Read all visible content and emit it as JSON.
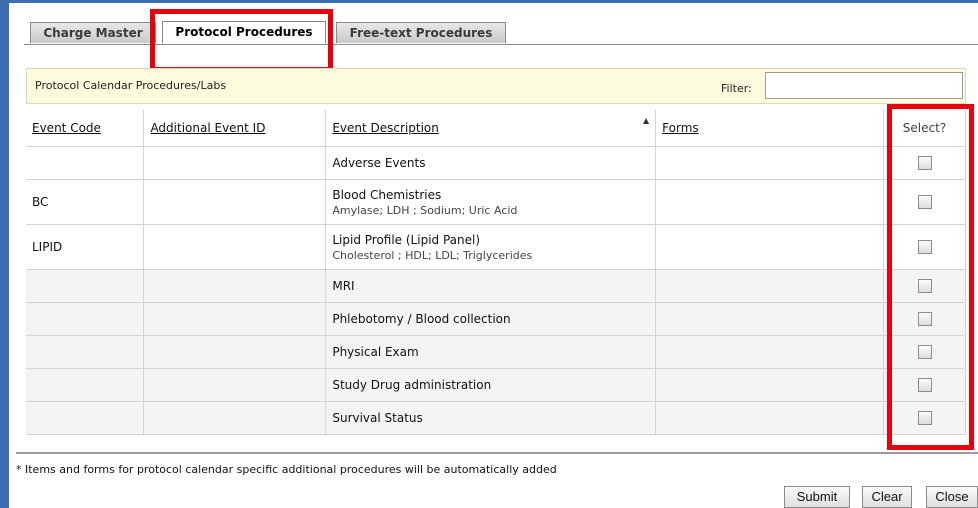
{
  "tabs": [
    {
      "label": "Charge Master"
    },
    {
      "label": "Protocol Procedures"
    },
    {
      "label": "Free-text Procedures"
    }
  ],
  "panel": {
    "title": "Protocol Calendar Procedures/Labs",
    "filter_label": "Filter:",
    "filter_value": ""
  },
  "table": {
    "headers": [
      "Event Code",
      "Additional Event ID",
      "Event Description",
      "Forms",
      "Select?"
    ],
    "rows": [
      {
        "code": "",
        "additional_id": "",
        "description": "Adverse Events",
        "details": "",
        "forms": ""
      },
      {
        "code": "BC",
        "additional_id": "",
        "description": "Blood Chemistries",
        "details": "Amylase; LDH ; Sodium; Uric Acid",
        "forms": ""
      },
      {
        "code": "LIPID",
        "additional_id": "",
        "description": "Lipid Profile (Lipid Panel)",
        "details": "Cholesterol ; HDL; LDL; Triglycerides",
        "forms": ""
      },
      {
        "code": "",
        "additional_id": "",
        "description": "MRI",
        "details": "",
        "forms": ""
      },
      {
        "code": "",
        "additional_id": "",
        "description": "Phlebotomy / Blood collection",
        "details": "",
        "forms": ""
      },
      {
        "code": "",
        "additional_id": "",
        "description": "Physical Exam",
        "details": "",
        "forms": ""
      },
      {
        "code": "",
        "additional_id": "",
        "description": "Study Drug administration",
        "details": "",
        "forms": ""
      },
      {
        "code": "",
        "additional_id": "",
        "description": "Survival Status",
        "details": "",
        "forms": ""
      }
    ]
  },
  "footer": {
    "note": "* Items and forms for protocol calendar specific additional procedures will be automatically added",
    "buttons": [
      "Submit",
      "Clear",
      "Close"
    ]
  },
  "colors": {
    "highlight": "#e8000e",
    "frame": "#3d6fb0",
    "filter_bg": "#fcfbdc"
  }
}
